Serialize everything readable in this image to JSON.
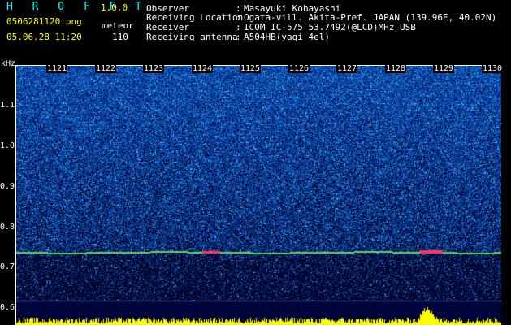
{
  "header": {
    "app_title": "H R O F F T",
    "version": "1.0.0",
    "file_name": "0506281120.png",
    "mode": "meteor",
    "datetime": "05.06.28 11:20",
    "count": "110"
  },
  "info": [
    {
      "key": "Observer",
      "sep": ":",
      "value": "Masayuki Kobayashi"
    },
    {
      "key": "Receiving Location",
      "sep": ":",
      "value": "Ogata-vill. Akita-Pref. JAPAN (139.96E, 40.02N)"
    },
    {
      "key": "Receiver",
      "sep": ":",
      "value": "ICOM IC-575 53.7492(@LCD)MHz USB"
    },
    {
      "key": "Receiving antenna",
      "sep": ":",
      "value": "A504HB(yagi 4el)"
    }
  ],
  "plot": {
    "y_unit": "kHz",
    "y_ticks": [
      "1.1",
      "1.0",
      "0.9",
      "0.8",
      "0.7",
      "0.6"
    ],
    "x_ticks": [
      "1121",
      "1122",
      "1123",
      "1124",
      "1125",
      "1126",
      "1127",
      "1128",
      "1129",
      "1130"
    ],
    "colors": {
      "text_cyan": "#00ffff",
      "text_yellow": "#ffff00",
      "carrier_line": "#5fd35f",
      "spike": "#ff3366",
      "histogram": "#ffff00",
      "background": "#000000"
    }
  }
}
